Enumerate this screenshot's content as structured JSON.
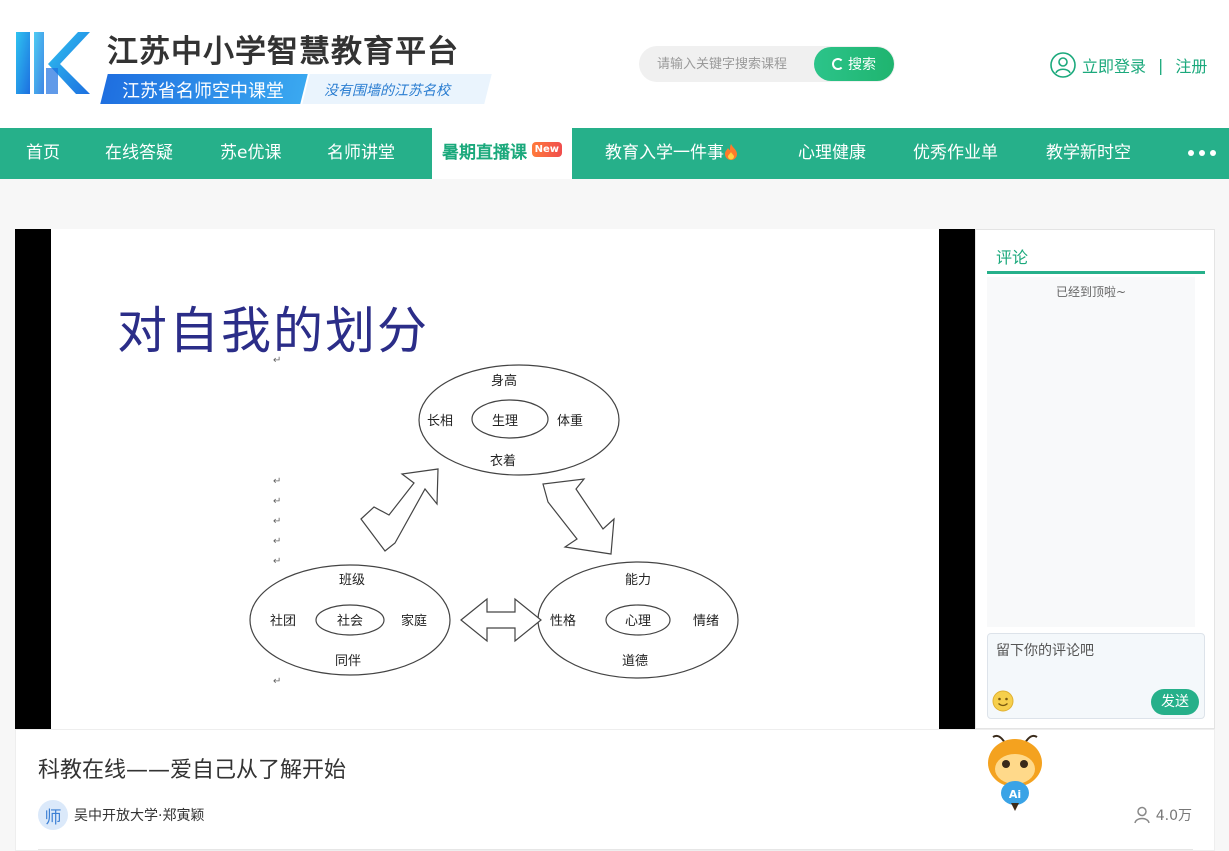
{
  "header": {
    "site_title": "江苏中小学智慧教育平台",
    "tag_main": "江苏省名师空中课堂",
    "tag_alt": "没有围墙的江苏名校",
    "search_placeholder": "请输入关键字搜索课程",
    "search_label": "搜索",
    "login_label": "立即登录",
    "divider": "|",
    "register_label": "注册"
  },
  "nav": {
    "items": [
      {
        "label": "首页"
      },
      {
        "label": "在线答疑"
      },
      {
        "label": "苏e优课"
      },
      {
        "label": "名师讲堂"
      },
      {
        "label": "暑期直播课",
        "badge": "New",
        "active": true
      },
      {
        "label": "教育入学一件事"
      },
      {
        "label": "心理健康"
      },
      {
        "label": "优秀作业单"
      },
      {
        "label": "教学新时空"
      }
    ]
  },
  "slide": {
    "title": "对自我的划分",
    "top_center": "生理",
    "top_labels": [
      "身高",
      "长相",
      "体重",
      "衣着"
    ],
    "left_center": "社会",
    "left_labels": [
      "班级",
      "社团",
      "家庭",
      "同伴"
    ],
    "right_center": "心理",
    "right_labels": [
      "能力",
      "性格",
      "情绪",
      "道德"
    ],
    "para_mark": "↵"
  },
  "comments": {
    "tab_label": "评论",
    "end_text": "已经到顶啦~",
    "input_placeholder": "留下你的评论吧",
    "send_label": "发送"
  },
  "video": {
    "title": "科教在线——爱自己从了解开始",
    "teacher_icon_text": "师",
    "author": "吴中开放大学·郑寅颖",
    "views": "4.0万"
  },
  "colors": {
    "brand_green": "#26b08a",
    "brand_blue": "#1f6fe0",
    "slide_title": "#2b2d88"
  }
}
